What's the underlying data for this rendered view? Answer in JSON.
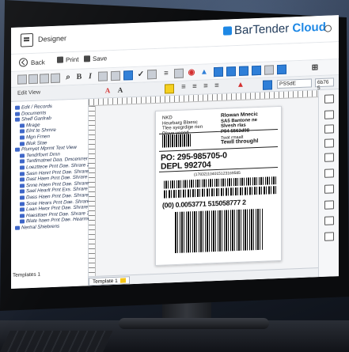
{
  "window": {
    "title": "Designer"
  },
  "brand": {
    "name": "BarTender",
    "cloud": "Cloud",
    "mark": "®"
  },
  "commands": {
    "back": "Back",
    "print": "Print",
    "save": "Save"
  },
  "toolbar": {
    "bold": "B",
    "italic": "I",
    "field_label": "Edit View",
    "font_name": "PSSdE",
    "font_size": "6b76 5"
  },
  "tree": {
    "items": [
      {
        "label": "Edit / Records",
        "level": 1
      },
      {
        "label": "Documents",
        "level": 1
      },
      {
        "label": "Shelf Ganlrab",
        "level": 1
      },
      {
        "label": "Mrage",
        "level": 2
      },
      {
        "label": "Elnt te Shrnre",
        "level": 2
      },
      {
        "label": "Mgn Frnen",
        "level": 2
      },
      {
        "label": "Bluk Stae",
        "level": 2
      },
      {
        "label": "Plumyet Mprmt Text View",
        "level": 1
      },
      {
        "label": "Tendrfovrt Drnn",
        "level": 2
      },
      {
        "label": "Tantlmatnet Daa. Dmcenrrer",
        "level": 2
      },
      {
        "label": "Loeztteoe Prnt Dae. Shrare 2",
        "level": 2
      },
      {
        "label": "Sasn Hanrt Prnt Dae. Shrare 1",
        "level": 2
      },
      {
        "label": "Dast Haen Prnt Dae. Shrare 7",
        "level": 2
      },
      {
        "label": "Snne Haen Prnt Dae. Shrare 3",
        "level": 2
      },
      {
        "label": "Sael Hearlt Prnt Exs. Shrare 4",
        "level": 2
      },
      {
        "label": "Dass Haen Prnt Dae. Shrare 5",
        "level": 2
      },
      {
        "label": "Sose Hears Prnt Dae. Shrare 8",
        "level": 2
      },
      {
        "label": "Laan Hwor Prnt Dae. Shrare 9",
        "level": 2
      },
      {
        "label": "Haesttaer Prnt Dae. Shrare 3",
        "level": 2
      },
      {
        "label": "Blate haen Prnt Dae. Hearme",
        "level": 2
      },
      {
        "label": "Nertral Shiebrens",
        "level": 1
      }
    ],
    "templates_label": "Templates 1"
  },
  "label": {
    "from_lines": [
      "NKD",
      "Heurbarg Blaesc",
      "Tlee syegrdige rien",
      "Dlave yepnd"
    ],
    "to_lines": [
      "Rlowan Mnecic",
      "SA5 Bantone ne",
      "Slvesh rlas",
      "P94 5563d98"
    ],
    "mini": [
      "Twat rmaalt",
      "Tewll throughl"
    ],
    "small_code": "Tewll thr",
    "po_line1": "PO: 295-985705-0",
    "po_line2": "DEPL 992704",
    "barcode_caption": "(17832)104015123169585",
    "sscc": "(00) 0.0053771 515058777 2"
  },
  "tabs": {
    "template": "Template 1"
  }
}
